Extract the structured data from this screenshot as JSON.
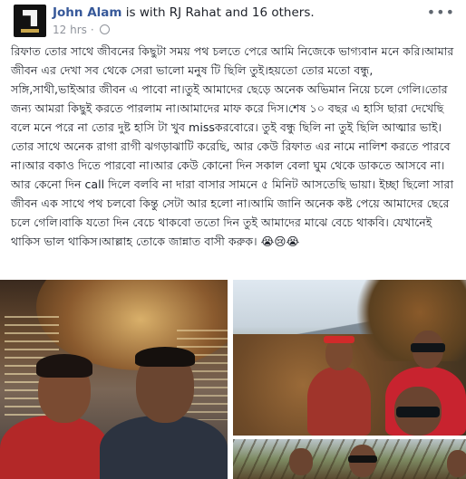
{
  "post": {
    "author": "John Alam",
    "with_text": "is with RJ Rahat and 16 others.",
    "time": "12 hrs",
    "privacy_icon": "globe-icon",
    "more_icon": "more-options-icon",
    "text": "রিফাত তোর সাথে জীবনের কিছুটা সময় পথ চলতে পেরে আমি নিজেকে ভাগ্যবান মনে করি।আমার জীবন এর দেখা সব থেকে সেরা ভালো মনুষ টি ছিলি তুই।হয়তো তোর মতো বন্ধু, সঙ্গি,সাথী,ভাইআর জীবন এ পাবো না।তুই আমাদের ছেড়ে অনেক অভিমান নিয়ে চলে গেলি।তোর জন্য আমরা কিছুই করতে পারলাম না।আমাদের মাফ করে দিস।শেষ ১০ বছর এ হাসি ছারা দেখেছি বলে মনে পরে না তোর দুষ্ট হাসি টা খুব missকরবোরে। তুই বন্ধু ছিলি না তুই ছিলি আত্মার ভাই।তোর সাথে অনেক রাগা রাগী ঝগড়াঝাটি করেছি, আর কেউ রিফাত এর নামে নালিশ করতে পারবে না।আর বকাও দিতে পারবো না।আর কেউ কোনো দিন সকাল বেলা ঘুম থেকে ডাকতে আসবে না।আর কেনো দিন call দিলে বলবি না দারা বাসার সামনে ৫ মিনিট আসতেছি ভায়া। ইচ্ছা ছিলো সারা জীবন এক সাথে পথ চলবো কিন্তু সেটা আর হলো না।আমি জানি অনেক কষ্ট পেয়ে আমাদের ছেরে চলে গেলি।বাকি যতো দিন বেচে থাকবো ততো দিন তুই আমাদের মাঝে বেচে থাকবি। যেখানেই থাকিস ভাল থাকিস।আল্লাহ তোকে জান্নাত বাসী করুক। 😭😢😭"
  },
  "photos": [
    {
      "name": "photo-selfie-indoor"
    },
    {
      "name": "photo-group-hillside"
    },
    {
      "name": "photo-group-bottom"
    }
  ]
}
